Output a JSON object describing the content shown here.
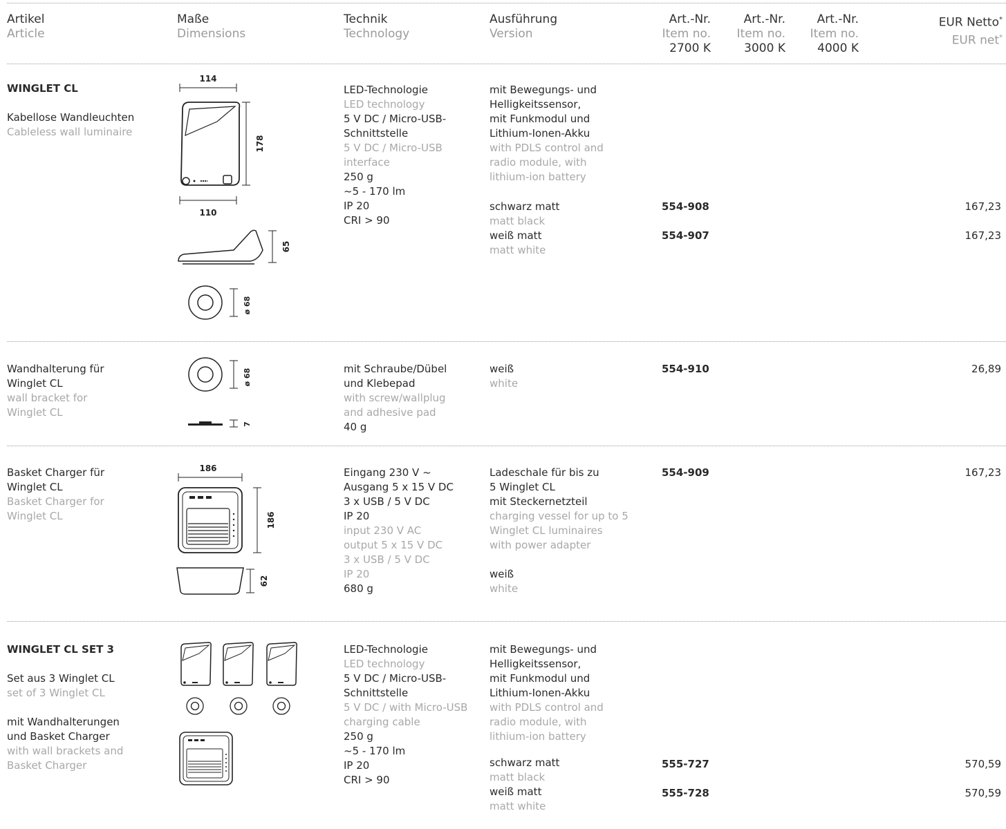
{
  "header": {
    "article": {
      "de": "Artikel",
      "en": "Article"
    },
    "dimensions": {
      "de": "Maße",
      "en": "Dimensions"
    },
    "technology": {
      "de": "Technik",
      "en": "Technology"
    },
    "version": {
      "de": "Ausführung",
      "en": "Version"
    },
    "item_cols": [
      {
        "de": "Art.-Nr.",
        "en": "Item no.",
        "k": "2700 K"
      },
      {
        "de": "Art.-Nr.",
        "en": "Item no.",
        "k": "3000 K"
      },
      {
        "de": "Art.-Nr.",
        "en": "Item no.",
        "k": "4000 K"
      }
    ],
    "price": {
      "de": "EUR Netto",
      "en": "EUR net",
      "mark": "*"
    }
  },
  "rows": [
    {
      "name": "WINGLET CL",
      "desc_de": "Kabellose Wandleuchten",
      "desc_en": "Cableless wall luminaire",
      "dims": {
        "top": "114",
        "side": "178",
        "bottom": "110",
        "depth": "65",
        "diameter": "ø 68"
      },
      "tech": [
        {
          "de": "LED-Technologie",
          "en": "LED technology"
        },
        {
          "de": "5 V DC / Micro-USB-",
          "de2": "Schnittstelle",
          "en": "5 V DC / Micro-USB",
          "en2": "interface"
        },
        {
          "de": "250 g"
        },
        {
          "de": "~5 - 170 lm"
        },
        {
          "de": "IP 20"
        },
        {
          "de": "CRI > 90"
        }
      ],
      "version_intro_de": [
        "mit Bewegungs- und",
        "Helligkeitssensor,",
        "mit Funkmodul und",
        "Lithium-Ionen-Akku"
      ],
      "version_intro_en": [
        "with PDLS control and",
        "radio module, with",
        "lithium-ion battery"
      ],
      "variants": [
        {
          "de": "schwarz matt",
          "en": "matt black",
          "art": "554-908",
          "price": "167,23"
        },
        {
          "de": "weiß matt",
          "en": "matt white",
          "art": "554-907",
          "price": "167,23"
        }
      ]
    },
    {
      "name_de": [
        "Wandhalterung für",
        "Winglet CL"
      ],
      "name_en": [
        "wall bracket for",
        "Winglet CL"
      ],
      "dims": {
        "diameter": "ø 68",
        "height": "7"
      },
      "tech_de": [
        "mit Schraube/Dübel",
        "und Klebepad"
      ],
      "tech_en": [
        "with screw/wallplug",
        "and adhesive pad"
      ],
      "tech_de2": "40 g",
      "variants": [
        {
          "de": "weiß",
          "en": "white",
          "art": "554-910",
          "price": "26,89"
        }
      ]
    },
    {
      "name_de": [
        "Basket Charger für",
        "Winglet CL"
      ],
      "name_en": [
        "Basket Charger for",
        "Winglet CL"
      ],
      "dims": {
        "top": "186",
        "side": "186",
        "depth": "62"
      },
      "tech_de": [
        "Eingang 230 V ~",
        "Ausgang 5 x 15 V DC",
        "3 x USB / 5 V DC",
        "IP 20"
      ],
      "tech_en": [
        "input 230 V AC",
        "output 5 x 15 V DC",
        "3 x USB / 5 V DC",
        "IP 20"
      ],
      "tech_de2": "680 g",
      "version_de": [
        "Ladeschale für bis zu",
        "5 Winglet CL",
        "mit Steckernetzteil"
      ],
      "version_en": [
        "charging vessel for up to 5",
        "Winglet CL luminaires",
        "with power adapter"
      ],
      "variants": [
        {
          "de": "weiß",
          "en": "white",
          "art": "554-909",
          "price": "167,23"
        }
      ]
    },
    {
      "name": "WINGLET CL SET 3",
      "desc_de": "Set aus 3 Winglet CL",
      "desc_en": "set of 3 Winglet CL",
      "desc2_de": [
        "mit Wandhalterungen",
        "und Basket Charger"
      ],
      "desc2_en": [
        "with wall brackets and",
        "Basket Charger"
      ],
      "tech": [
        {
          "de": "LED-Technologie",
          "en": "LED technology"
        },
        {
          "de": "5 V DC / Micro-USB-",
          "de2": "Schnittstelle",
          "en": "5 V DC / with Micro-USB",
          "en2": "charging cable"
        },
        {
          "de": "250 g"
        },
        {
          "de": "~5 - 170 lm"
        },
        {
          "de": "IP 20"
        },
        {
          "de": "CRI > 90"
        }
      ],
      "version_intro_de": [
        "mit Bewegungs- und",
        "Helligkeitssensor,",
        "mit Funkmodul und",
        "Lithium-Ionen-Akku"
      ],
      "version_intro_en": [
        "with PDLS control and",
        "radio module, with",
        "lithium-ion battery"
      ],
      "variants": [
        {
          "de": "schwarz matt",
          "en": "matt black",
          "art": "555-727",
          "price": "570,59"
        },
        {
          "de": "weiß matt",
          "en": "matt white",
          "art": "555-728",
          "price": "570,59"
        }
      ]
    }
  ]
}
